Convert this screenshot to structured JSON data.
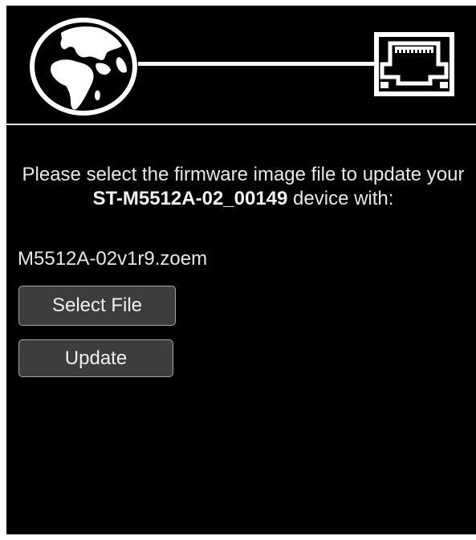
{
  "header": {
    "globe_icon": "globe-icon",
    "ethernet_icon": "ethernet-port-icon",
    "colors": {
      "background": "#000000",
      "foreground": "#ffffff"
    }
  },
  "message": {
    "prefix": "Please select the firmware image file to update your ",
    "device_name": "ST-M5512A-02_00149",
    "suffix": " device with:"
  },
  "firmware_file": "M5512A-02v1r9.zoem",
  "buttons": {
    "select_label": "Select File",
    "update_label": "Update",
    "background": "#3d3d3d",
    "border": "#a6a6a6"
  }
}
